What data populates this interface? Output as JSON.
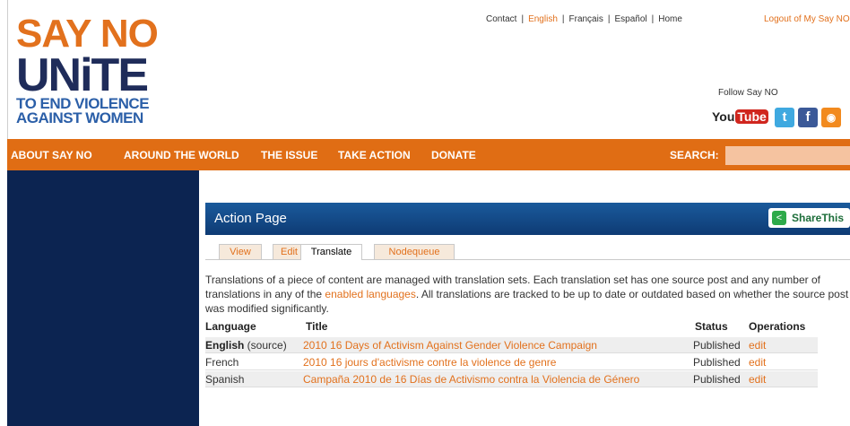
{
  "logo": {
    "line1": "SAY NO",
    "line2": "UNiTE",
    "line3": "TO END VIOLENCE",
    "line4": "AGAINST WOMEN"
  },
  "toplinks": {
    "contact": "Contact",
    "english": "English",
    "francais": "Français",
    "espanol": "Español",
    "home": "Home",
    "separator": "|"
  },
  "logout": "Logout of My Say NO",
  "follow": "Follow Say NO",
  "social": {
    "youtube_you": "You",
    "youtube_tube": "Tube",
    "twitter_glyph": "t",
    "facebook_glyph": "f",
    "rss_glyph": "◉"
  },
  "nav": {
    "items": [
      "ABOUT SAY NO",
      "AROUND THE WORLD",
      "THE ISSUE",
      "TAKE ACTION",
      "DONATE"
    ],
    "search_label": "SEARCH:"
  },
  "page": {
    "title": "Action Page",
    "share_label": "ShareThis",
    "tabs": [
      "View",
      "Edit",
      "Translate",
      "Nodequeue"
    ],
    "active_tab": "Translate",
    "description_1": "Translations of a piece of content are managed with translation sets. Each translation set has one source post and any number of translations in any of the ",
    "description_link": "enabled languages",
    "description_2": ". All translations are tracked to be up to date or outdated based on whether the source post was modified significantly."
  },
  "table": {
    "headers": [
      "Language",
      "Title",
      "Status",
      "Operations"
    ],
    "rows": [
      {
        "language": "English",
        "language_note": " (source)",
        "title": "2010 16 Days of Activism Against Gender Violence Campaign",
        "status": "Published",
        "op": "edit"
      },
      {
        "language": "French",
        "language_note": "",
        "title": "2010 16 jours d'activisme contre la violence de genre",
        "status": "Published",
        "op": "edit"
      },
      {
        "language": "Spanish",
        "language_note": "",
        "title": "Campaña 2010 de 16 Días de Activismo contra la Violencia de Género",
        "status": "Published",
        "op": "edit"
      }
    ]
  },
  "colors": {
    "accent_orange": "#e06d14",
    "navy": "#0c2451",
    "title_blue": "#1a5a9c"
  }
}
